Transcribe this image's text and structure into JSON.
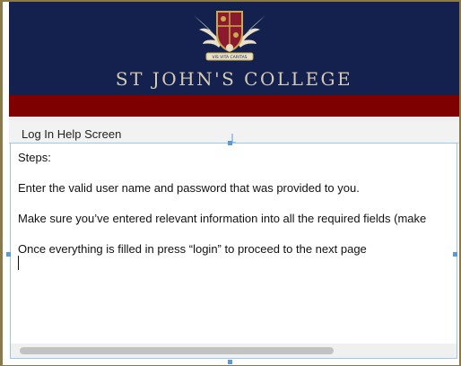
{
  "banner": {
    "title": "ST JOHN'S COLLEGE",
    "crest_motto": "VIS VITA CARITAS",
    "colors": {
      "navy": "#14214e",
      "crimson": "#7e0000",
      "gold": "#c9a94a"
    }
  },
  "help_tab": {
    "label": "Log In Help Screen"
  },
  "help_text": {
    "lines": [
      "Steps:",
      "Enter the valid user name and password that was provided to you.",
      "Make sure you’ve entered relevant information into all the required fields (make",
      "Once everything is filled in press “login” to proceed to the next page"
    ]
  }
}
